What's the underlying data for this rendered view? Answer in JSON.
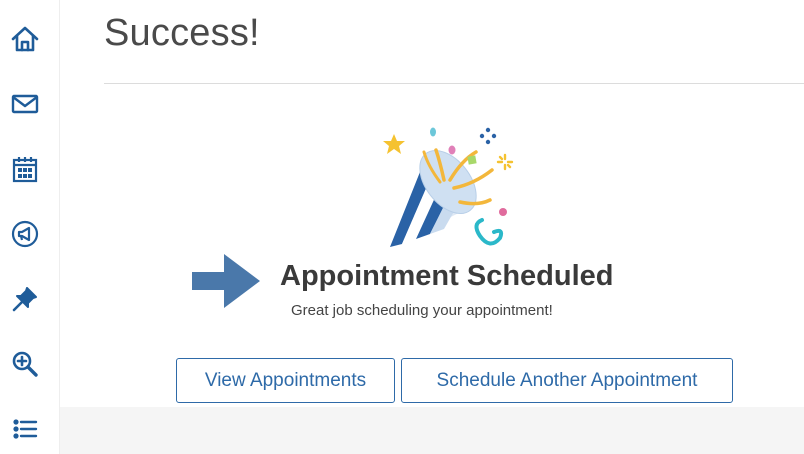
{
  "page": {
    "title": "Success!"
  },
  "confirmation": {
    "heading": "Appointment Scheduled",
    "message": "Great job scheduling your appointment!"
  },
  "actions": {
    "view_label": "View Appointments",
    "schedule_label": "Schedule Another Appointment"
  },
  "sidebar": {
    "icons": [
      "home-icon",
      "mail-icon",
      "calendar-icon",
      "announcement-icon",
      "pin-icon",
      "zoom-in-icon",
      "list-icon"
    ]
  },
  "colors": {
    "accent": "#2e6aa8",
    "icon": "#1f5c99",
    "arrow": "#4a78aa"
  }
}
